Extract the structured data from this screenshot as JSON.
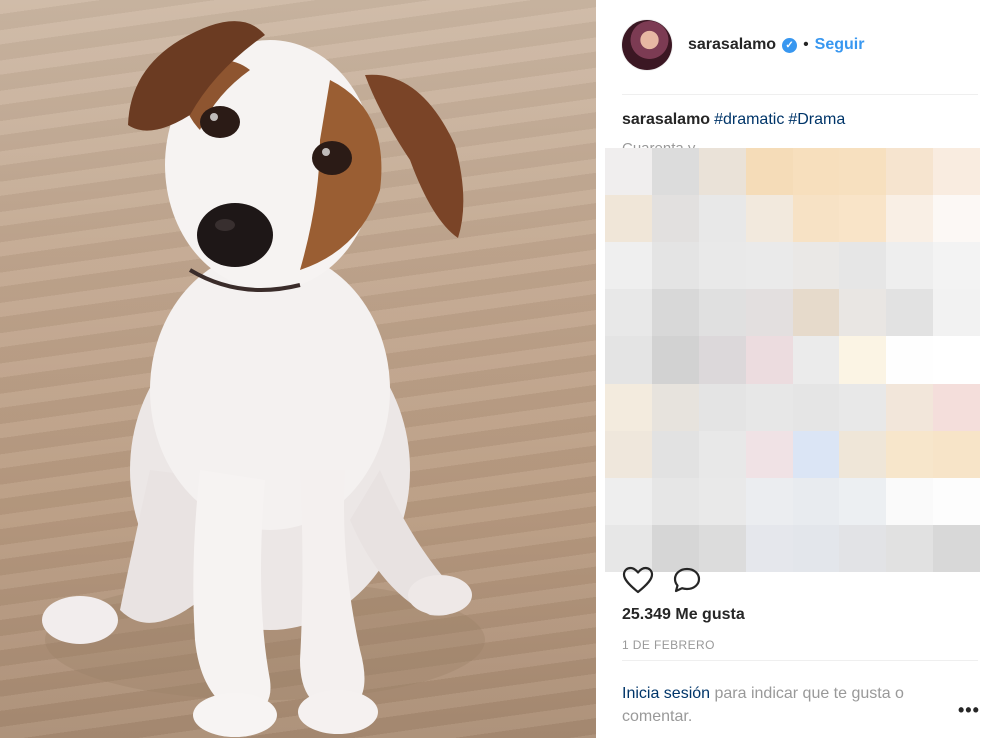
{
  "header": {
    "username": "sarasalamo",
    "verified_icon": "verified-check-icon",
    "separator": "•",
    "follow_label": "Seguir"
  },
  "caption": {
    "username": "sarasalamo",
    "hashtags": [
      "#dramatic",
      "#Drama"
    ],
    "partial_text": "Cuarenta y..."
  },
  "actions": {
    "like_icon": "heart-icon",
    "comment_icon": "speech-bubble-icon"
  },
  "likes": "25.349 Me gusta",
  "date": "1 DE FEBRERO",
  "login_prompt": {
    "link": "Inicia sesión",
    "text": " para indicar que te gusta o comentar.",
    "more": "•••"
  },
  "colors": {
    "accent_blue": "#3897f0",
    "link_dark_blue": "#003569",
    "muted_text": "#999999",
    "divider": "#efefef"
  },
  "mosaic_colors": [
    [
      "#f0eeee",
      "#dcdcdc",
      "#eae2d8",
      "#f5dcb8",
      "#f7dfbd",
      "#f7e0bf",
      "#f6e4cf",
      "#f9ece0"
    ],
    [
      "#f0e6d8",
      "#e2e0df",
      "#e8e8e8",
      "#f2e9dd",
      "#f7e2c5",
      "#f9e4c8",
      "#f9efe5",
      "#fcf8f5"
    ],
    [
      "#efefef",
      "#e4e4e4",
      "#e9e9e9",
      "#eaeaea",
      "#eae8e6",
      "#e6e6e6",
      "#eeeeee",
      "#f3f3f3"
    ],
    [
      "#e8e8e8",
      "#d8d8d8",
      "#e0e0e0",
      "#e3dfdf",
      "#e6dacb",
      "#e9e6e3",
      "#e2e2e2",
      "#f2f2f2"
    ],
    [
      "#e4e4e4",
      "#d2d2d2",
      "#dcd8da",
      "#ecdcdf",
      "#ebebeb",
      "#fbf4e4",
      "#fefefe",
      "#ffffff"
    ],
    [
      "#f3ebde",
      "#e7e3dd",
      "#e4e4e4",
      "#e7e7e7",
      "#e5e5e5",
      "#e8e8e8",
      "#f2e6da",
      "#f4dedb"
    ],
    [
      "#efe7dc",
      "#e2e2e2",
      "#e8e8e8",
      "#f0e2e5",
      "#dbe5f5",
      "#efe6d8",
      "#f7e6cb",
      "#f7e4c8"
    ],
    [
      "#eeeeee",
      "#e6e6e6",
      "#e9e9e9",
      "#ebedf0",
      "#e8ebef",
      "#eceff2",
      "#fafafa",
      "#fdfdfd"
    ],
    [
      "#e7e7e7",
      "#d6d6d6",
      "#dcdcdc",
      "#e5e7ec",
      "#e3e6eb",
      "#e2e3e6",
      "#e1e1e1",
      "#d8d8d8"
    ]
  ]
}
